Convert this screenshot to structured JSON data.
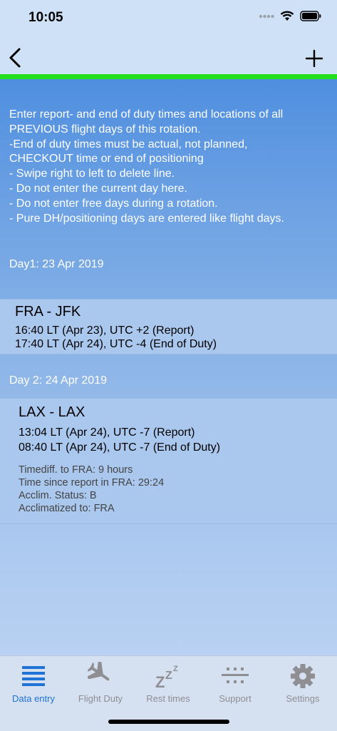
{
  "status": {
    "time": "10:05"
  },
  "instructions": [
    "Enter report- and end of duty times and locations of all",
    "PREVIOUS flight days of this rotation.",
    "-End of duty times must be actual, not planned,",
    "CHECKOUT time or end of positioning",
    "- Swipe right to left to delete line.",
    "- Do not enter the current day here.",
    "- Do not enter free days during a rotation.",
    "- Pure DH/positioning days are entered like flight days."
  ],
  "days": [
    {
      "header": "Day1: 23 Apr 2019",
      "route": "FRA - JFK",
      "report": "16:40 LT (Apr 23), UTC +2 (Report)",
      "end": "17:40 LT (Apr 24), UTC -4 (End of Duty)"
    },
    {
      "header": "Day 2: 24 Apr 2019",
      "route": "LAX - LAX",
      "report": "13:04 LT (Apr 24), UTC -7 (Report)",
      "end": "08:40 LT (Apr 24), UTC -7 (End of Duty)",
      "info": [
        "Timediff. to FRA: 9 hours",
        "Time since report in FRA: 29:24",
        "Acclim. Status: B",
        "Acclimatized to: FRA"
      ]
    }
  ],
  "tabs": [
    {
      "label": "Data entry",
      "icon": "list-icon",
      "active": true
    },
    {
      "label": "Flight Duty",
      "icon": "airplane-icon",
      "active": false
    },
    {
      "label": "Rest times",
      "icon": "sleep-icon",
      "active": false
    },
    {
      "label": "Support",
      "icon": "support-icon",
      "active": false
    },
    {
      "label": "Settings",
      "icon": "gear-icon",
      "active": false
    }
  ],
  "colors": {
    "accent": "#1f72d6",
    "progress": "#22e01c",
    "inactive": "#8e8e93"
  }
}
